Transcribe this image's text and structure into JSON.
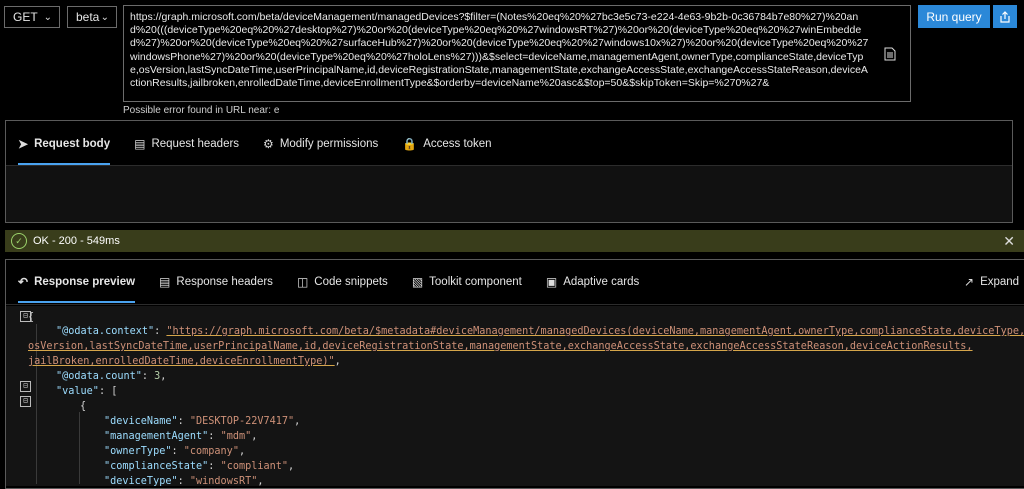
{
  "toolbar": {
    "method": "GET",
    "version": "beta",
    "url": "https://graph.microsoft.com/beta/deviceManagement/managedDevices?$filter=(Notes%20eq%20%27bc3e5c73-e224-4e63-9b2b-0c36784b7e80%27)%20and%20(((deviceType%20eq%20%27desktop%27)%20or%20(deviceType%20eq%20%27windowsRT%27)%20or%20(deviceType%20eq%20%27winEmbedded%27)%20or%20(deviceType%20eq%20%27surfaceHub%27)%20or%20(deviceType%20eq%20%27windows10x%27)%20or%20(deviceType%20eq%20%27windowsPhone%27)%20or%20(deviceType%20eq%20%27holoLens%27)))&$select=deviceName,managementAgent,ownerType,complianceState,deviceType,osVersion,lastSyncDateTime,userPrincipalName,id,deviceRegistrationState,managementState,exchangeAccessState,exchangeAccessStateReason,deviceActionResults,jailbroken,enrolledDateTime,deviceEnrollmentType&$orderby=deviceName%20asc&$top=50&$skipToken=Skip=%270%27&",
    "run_label": "Run query",
    "hint": "Possible error found in URL near: e"
  },
  "request_tabs": [
    {
      "label": "Request body",
      "icon": "send-icon"
    },
    {
      "label": "Request headers",
      "icon": "headers-icon"
    },
    {
      "label": "Modify permissions",
      "icon": "permissions-icon"
    },
    {
      "label": "Access token",
      "icon": "lock-icon"
    }
  ],
  "status": {
    "text": "OK - 200 - 549ms",
    "color": "#393d1b"
  },
  "response_tabs": [
    {
      "label": "Response preview",
      "icon": "undo-icon"
    },
    {
      "label": "Response headers",
      "icon": "headers-icon"
    },
    {
      "label": "Code snippets",
      "icon": "code-icon"
    },
    {
      "label": "Toolkit component",
      "icon": "toolkit-icon"
    },
    {
      "label": "Adaptive cards",
      "icon": "cards-icon"
    }
  ],
  "expand_label": "Expand",
  "code": {
    "open_brace": "{",
    "context_key": "\"@odata.context\"",
    "context_val_1": "\"https://graph.microsoft.com/beta/$metadata#deviceManagement/managedDevices(deviceName,managementAgent,ownerType,complianceState,deviceType,",
    "context_val_2": "osVersion,lastSyncDateTime,userPrincipalName,id,deviceRegistrationState,managementState,exchangeAccessState,exchangeAccessStateReason,deviceActionResults,",
    "context_val_3": "jailBroken,enrolledDateTime,deviceEnrollmentType)\"",
    "count_key": "\"@odata.count\"",
    "count_val": "3",
    "value_key": "\"value\"",
    "open_bracket": "[",
    "item_brace": "{",
    "fields": [
      {
        "key": "\"deviceName\"",
        "val": "\"DESKTOP-22V7417\""
      },
      {
        "key": "\"managementAgent\"",
        "val": "\"mdm\""
      },
      {
        "key": "\"ownerType\"",
        "val": "\"company\""
      },
      {
        "key": "\"complianceState\"",
        "val": "\"compliant\""
      },
      {
        "key": "\"deviceType\"",
        "val": "\"windowsRT\""
      }
    ]
  }
}
